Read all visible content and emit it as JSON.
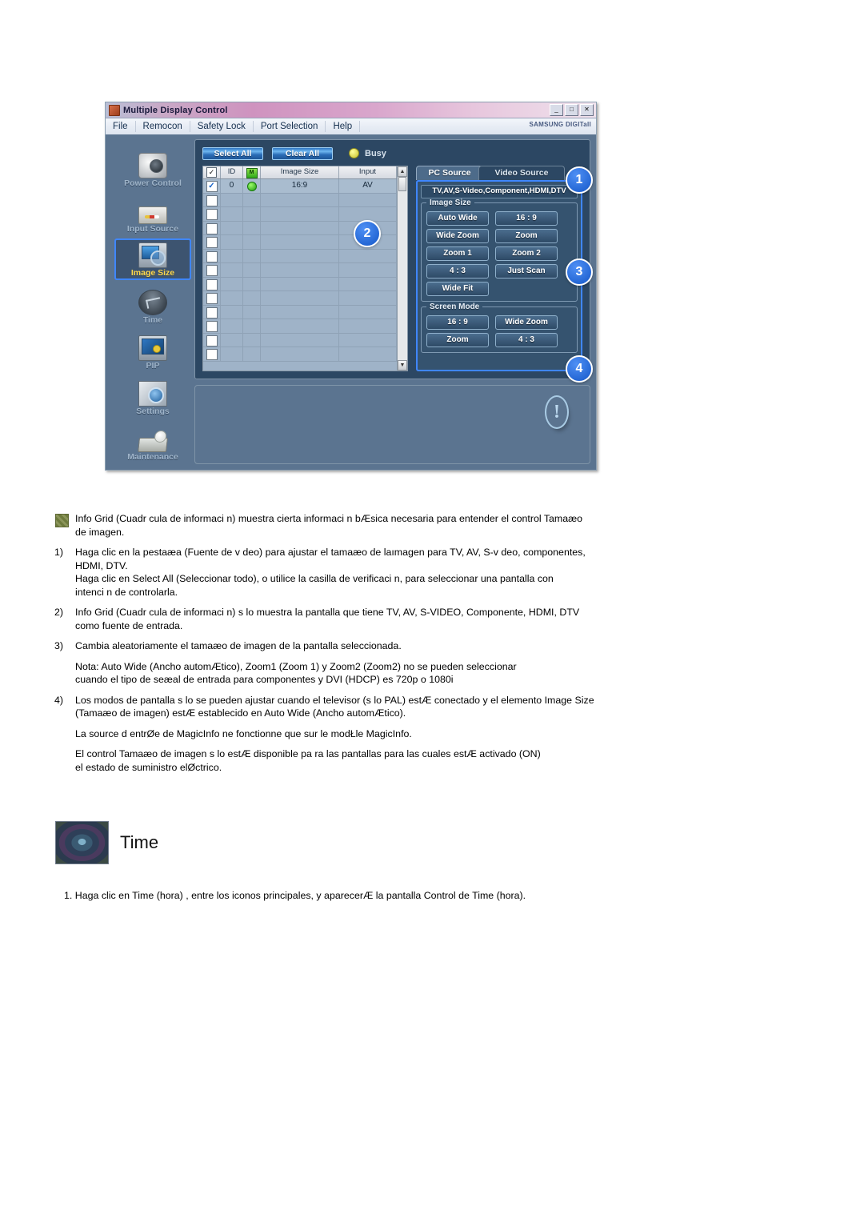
{
  "app": {
    "title": "Multiple Display Control",
    "title_icon": "app-icon",
    "window_buttons": [
      {
        "name": "minimize-button",
        "glyph": "_"
      },
      {
        "name": "maximize-button",
        "glyph": "□"
      },
      {
        "name": "close-button",
        "glyph": "✕"
      }
    ],
    "menu": [
      "File",
      "Remocon",
      "Safety Lock",
      "Port Selection",
      "Help"
    ],
    "brand": "SAMSUNG DIGITall",
    "sidebar": [
      {
        "label": "Power Control",
        "icon": "power-control-icon",
        "active": false
      },
      {
        "label": "Input Source",
        "icon": "input-source-icon",
        "active": false
      },
      {
        "label": "Image Size",
        "icon": "image-size-icon",
        "active": true
      },
      {
        "label": "Time",
        "icon": "time-icon",
        "active": false
      },
      {
        "label": "PIP",
        "icon": "pip-icon",
        "active": false
      },
      {
        "label": "Settings",
        "icon": "settings-icon",
        "active": false
      },
      {
        "label": "Maintenance",
        "icon": "maintenance-icon",
        "active": false
      }
    ],
    "toolbar": {
      "select_all": "Select All",
      "clear_all": "Clear All",
      "status_label": "Busy",
      "status_led_color": "#d8d42e"
    },
    "grid": {
      "columns": [
        "",
        "ID",
        "",
        "Image Size",
        "Input"
      ],
      "header_checkbox_glyph": "✓",
      "header_power_glyph": "M",
      "rows": [
        {
          "checked": true,
          "id": "0",
          "power": "on",
          "image_size": "16:9",
          "input": "AV"
        },
        {
          "checked": false,
          "id": "",
          "power": "",
          "image_size": "",
          "input": ""
        },
        {
          "checked": false,
          "id": "",
          "power": "",
          "image_size": "",
          "input": ""
        },
        {
          "checked": false,
          "id": "",
          "power": "",
          "image_size": "",
          "input": ""
        },
        {
          "checked": false,
          "id": "",
          "power": "",
          "image_size": "",
          "input": ""
        },
        {
          "checked": false,
          "id": "",
          "power": "",
          "image_size": "",
          "input": ""
        },
        {
          "checked": false,
          "id": "",
          "power": "",
          "image_size": "",
          "input": ""
        },
        {
          "checked": false,
          "id": "",
          "power": "",
          "image_size": "",
          "input": ""
        },
        {
          "checked": false,
          "id": "",
          "power": "",
          "image_size": "",
          "input": ""
        },
        {
          "checked": false,
          "id": "",
          "power": "",
          "image_size": "",
          "input": ""
        },
        {
          "checked": false,
          "id": "",
          "power": "",
          "image_size": "",
          "input": ""
        },
        {
          "checked": false,
          "id": "",
          "power": "",
          "image_size": "",
          "input": ""
        },
        {
          "checked": false,
          "id": "",
          "power": "",
          "image_size": "",
          "input": ""
        }
      ],
      "scroll_up_glyph": "▲",
      "scroll_down_glyph": "▼"
    },
    "tabs": [
      {
        "label": "PC Source",
        "active": true
      },
      {
        "label": "Video Source",
        "active": false
      }
    ],
    "panel": {
      "source_label": "TV,AV,S-Video,Component,HDMI,DTV",
      "image_size_group": {
        "title": "Image Size",
        "buttons": [
          "Auto Wide",
          "16 : 9",
          "Wide Zoom",
          "Zoom",
          "Zoom 1",
          "Zoom 2",
          "4 : 3",
          "Just Scan",
          "Wide Fit"
        ]
      },
      "screen_mode_group": {
        "title": "Screen Mode",
        "buttons": [
          "16 : 9",
          "Wide Zoom",
          "Zoom",
          "4 : 3"
        ]
      }
    },
    "info_icon_glyph": "!",
    "callouts": [
      {
        "number": "1"
      },
      {
        "number": "2"
      },
      {
        "number": "3"
      },
      {
        "number": "4"
      }
    ],
    "accent_color": "#1457c8",
    "highlight_color": "#3f86ff"
  },
  "doc": {
    "bullet": {
      "line1": "Info Grid (Cuadr cula de informaci n) muestra cierta informaci n bÆsica necesaria para entender el control Tamaæo",
      "line2": "de imagen."
    },
    "items": [
      {
        "num": "1)",
        "lines": [
          "Haga clic en la pestaæa (Fuente de v deo) para ajustar el tamaæo de laımagen para TV, AV, S-v deo, componentes,",
          "HDMI, DTV.",
          "Haga clic en Select All (Seleccionar todo), o utilice la casilla de verificaci n, para seleccionar una pantalla con",
          "intenci n de controlarla."
        ]
      },
      {
        "num": "2)",
        "lines": [
          "Info Grid (Cuadr cula de informaci n) s lo muestra la pantalla que tiene TV, AV, S-VIDEO, Componente, HDMI, DTV",
          "como fuente de entrada."
        ]
      },
      {
        "num": "3)",
        "lines": [
          "Cambia aleatoriamente el tamaæo de imagen de la pantalla seleccionada."
        ]
      }
    ],
    "note3": {
      "line1": "Nota: Auto Wide (Ancho automÆtico), Zoom1 (Zoom        1) y Zoom2 (Zoom2) no se pueden seleccionar",
      "line2": "cuando el tipo de seæal de entrada para        componentes y DVI (HDCP) es 720p o 1080i"
    },
    "item4": {
      "num": "4)",
      "lines": [
        "Los modos de pantalla s lo se pueden ajustar cuando el televisor (s lo PAL) estÆ conectado y el elemento Image Size",
        "(Tamaæo de imagen) estÆ establecido en Auto Wide (Ancho automÆtico)."
      ]
    },
    "note4a": "La source d entrØe de MagicInfo ne fonctionne que sur le modŁle MagicInfo.",
    "note4b": {
      "line1": "El control Tamaæo de imagen s lo estÆ disponible pa        ra las pantallas para las cuales estÆ activado (ON)",
      "line2": "el estado de suministro elØctrico."
    },
    "time_section": {
      "heading": "Time",
      "icon": "time-section-icon",
      "step1": "1.  Haga clic en Time (hora) , entre los iconos principales, y aparecerÆ la pantalla Control de Time (hora)."
    }
  }
}
